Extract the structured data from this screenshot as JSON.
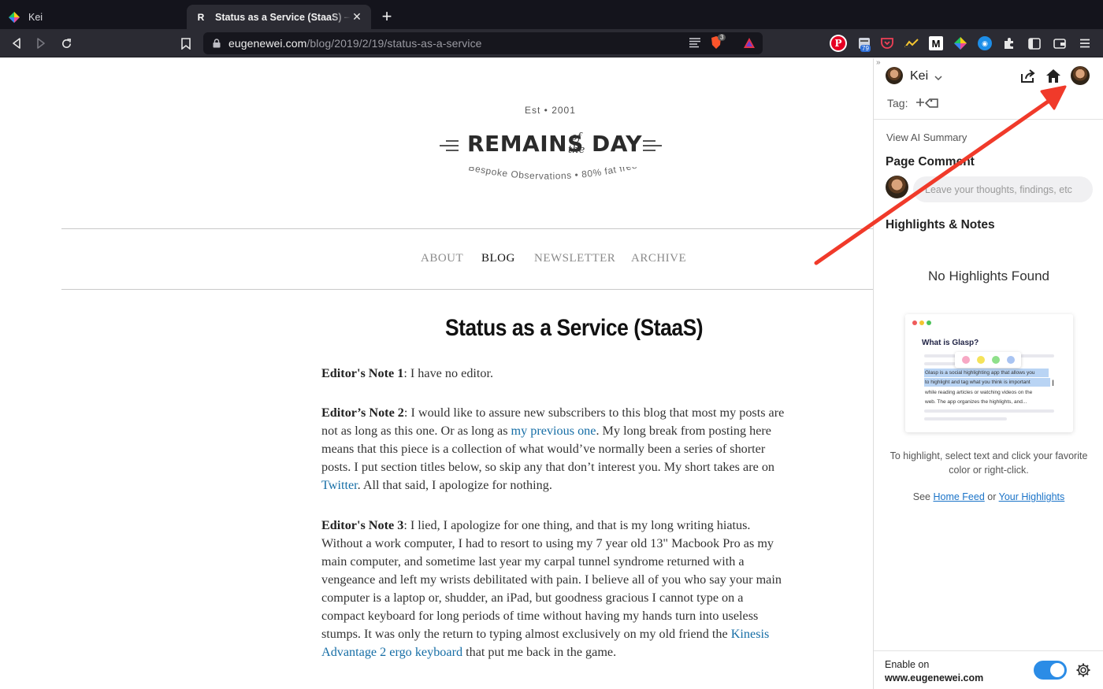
{
  "browser": {
    "tabs": [
      {
        "title": "Kei",
        "active": false
      },
      {
        "title": "Status as a Service (StaaS) — Remains of the Day",
        "active": true,
        "favicon": "R"
      }
    ],
    "url": {
      "host": "eugenewei.com",
      "path": "/blog/2019/2/19/status-as-a-service"
    },
    "extension_badges": {
      "brave_shields": "3",
      "reader": "79"
    }
  },
  "site": {
    "est": "Est • 2001",
    "logo": {
      "remains": "REMAINS",
      "of": "of",
      "the": "the",
      "day": "DAY"
    },
    "tagline": "Bespoke Observations • 80% fat free",
    "nav": [
      "ABOUT",
      "BLOG",
      "NEWSLETTER",
      "ARCHIVE"
    ],
    "nav_active": "BLOG"
  },
  "article": {
    "title": "Status as a Service (StaaS)",
    "p1": {
      "label": "Editor's Note 1",
      "text": ": I have no editor."
    },
    "p2": {
      "label": "Editor’s Note 2",
      "t1": ": I would like to assure new subscribers to this blog that most my posts are not as long as this one. Or as long as ",
      "link1": "my previous one",
      "t2": ". My long break from posting here means that this piece is a collection of what would’ve normally been a series of shorter posts. I put section titles below, so skip any that don’t interest you. My short takes are on ",
      "link2": "Twitter",
      "t3": ". All that said, I apologize for nothing."
    },
    "p3": {
      "label": "Editor's Note 3",
      "t1": ": I lied, I apologize for one thing, and that is my long writing hiatus. Without a work computer, I had to resort to using my 7 year old 13\" Macbook Pro as my main computer, and sometime last year my carpal tunnel syndrome returned with a vengeance and left my wrists debilitated with pain. I believe all of you who say your main computer is a laptop or, shudder, an iPad, but goodness gracious I cannot type on a compact keyboard for long periods of time without having my hands turn into useless stumps. It was only the return to typing almost exclusively on my old friend the ",
      "link1": "Kinesis Advantage 2 ergo keyboard",
      "t2": " that put me back in the game."
    }
  },
  "sidebar": {
    "user": "Kei",
    "tag_label": "Tag:",
    "ai_summary": "View AI Summary",
    "page_comment": "Page Comment",
    "comment_placeholder": "Leave your thoughts, findings, etc",
    "highlights_heading": "Highlights & Notes",
    "empty": "No Highlights Found",
    "demo": {
      "title": "What is Glasp?",
      "lines": [
        "Glasp is a social highlighting app that allows you",
        "to highlight and tag what you think is important",
        "while reading articles or watching videos on the",
        "web. The app organizes the highlights, and..."
      ]
    },
    "help": "To highlight, select text and click your favorite color or right-click.",
    "see_prefix": "See ",
    "see_link1": "Home Feed",
    "see_or": " or ",
    "see_link2": "Your Highlights",
    "enable_label": "Enable on",
    "enable_site": "www.eugenewei.com",
    "enabled": true
  },
  "colors": {
    "accent": "#2b8ce6",
    "link": "#166ea6",
    "annotation_arrow": "#f03a2a"
  }
}
